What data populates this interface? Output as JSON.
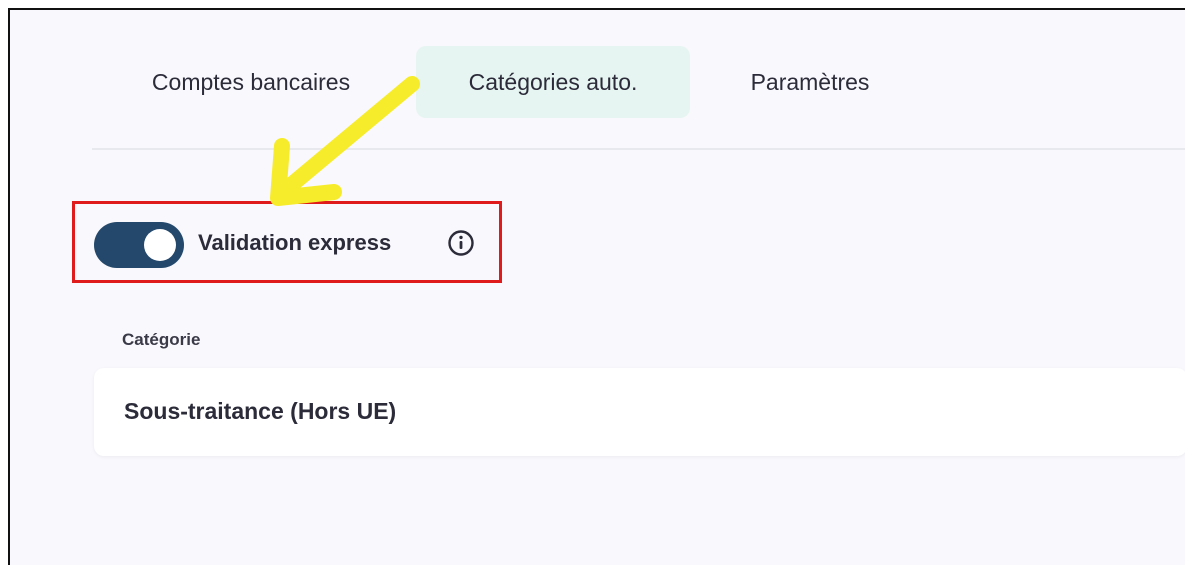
{
  "tabs": [
    {
      "label": "Comptes bancaires",
      "active": false
    },
    {
      "label": "Catégories auto.",
      "active": true
    },
    {
      "label": "Paramètres",
      "active": false
    }
  ],
  "validation": {
    "label": "Validation express",
    "enabled": true,
    "info_icon": "info-circle-icon"
  },
  "category": {
    "label": "Catégorie",
    "value": "Sous-traitance (Hors UE)"
  },
  "annotation": {
    "arrow_color": "#f7ec2b",
    "box_color": "#e01b1b"
  },
  "colors": {
    "active_tab_bg": "#e6f5f1",
    "toggle_on": "#23486b",
    "page_bg": "#f9f8fc"
  }
}
